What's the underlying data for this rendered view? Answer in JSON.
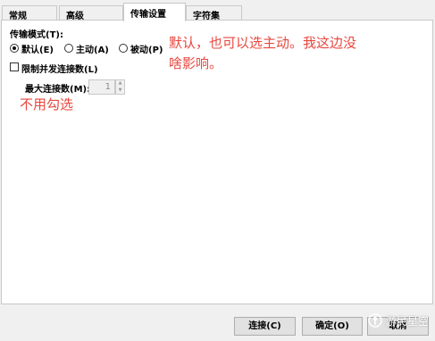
{
  "tabs": [
    {
      "label": "常规",
      "active": false
    },
    {
      "label": "高级",
      "active": false
    },
    {
      "label": "传输设置",
      "active": true
    },
    {
      "label": "字符集",
      "active": false
    }
  ],
  "transfer": {
    "mode_label": "传输模式(T):",
    "options": [
      {
        "label": "默认(E)",
        "checked": true
      },
      {
        "label": "主动(A)",
        "checked": false
      },
      {
        "label": "被动(P)",
        "checked": false
      }
    ],
    "limit_label": "限制并发连接数(L)",
    "limit_checked": false,
    "max_conn_label": "最大连接数(M):",
    "max_conn_value": "1"
  },
  "annotations": {
    "note1_line1": "默认，也可以选主动。我这边没",
    "note1_line2": "啥影响。",
    "note2": "不用勾选",
    "color": "#e8473f"
  },
  "buttons": {
    "connect": "连接(C)",
    "ok": "确定(O)",
    "cancel": "取消"
  },
  "watermark": {
    "logo_icon": "joystick-icon",
    "text": "游民星空"
  }
}
